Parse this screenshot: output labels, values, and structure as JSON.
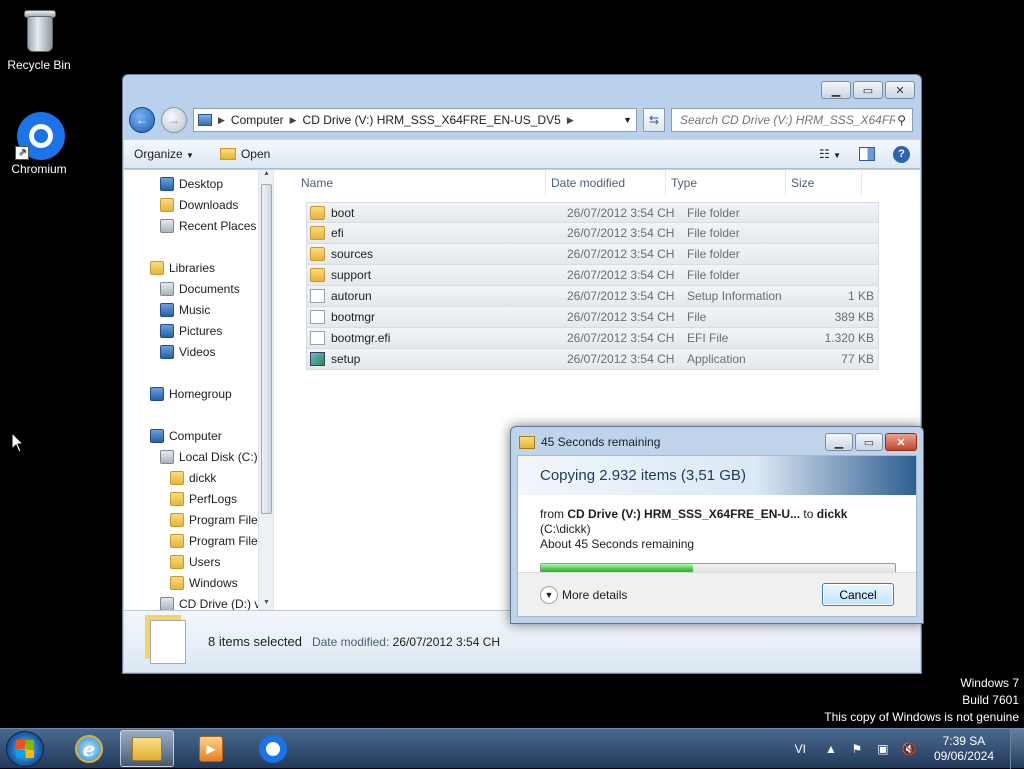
{
  "desktop": {
    "icons": [
      {
        "label": "Recycle Bin",
        "icon": "recycle-bin-icon"
      },
      {
        "label": "Chromium",
        "icon": "chromium-icon"
      }
    ],
    "watermark": [
      "Windows 7",
      "Build 7601",
      "This copy of Windows is not genuine"
    ]
  },
  "explorer": {
    "address": {
      "crumbs": [
        "Computer",
        "CD Drive (V:) HRM_SSS_X64FRE_EN-US_DV5"
      ]
    },
    "search_placeholder": "Search CD Drive (V:) HRM_SSS_X64FR...",
    "toolbar": {
      "organize": "Organize",
      "open": "Open"
    },
    "nav": {
      "favorites": [
        "Desktop",
        "Downloads",
        "Recent Places"
      ],
      "libraries_label": "Libraries",
      "libraries": [
        "Documents",
        "Music",
        "Pictures",
        "Videos"
      ],
      "homegroup": "Homegroup",
      "computer_label": "Computer",
      "local_disk": "Local Disk (C:)",
      "local_disk_children": [
        "dickk",
        "PerfLogs",
        "Program Files",
        "Program Files (",
        "Users",
        "Windows"
      ],
      "cd_drive": "CD Drive (D:) virt"
    },
    "columns": [
      "Name",
      "Date modified",
      "Type",
      "Size"
    ],
    "files": [
      {
        "name": "boot",
        "date": "26/07/2012 3:54 CH",
        "type": "File folder",
        "size": "",
        "icon": "folder"
      },
      {
        "name": "efi",
        "date": "26/07/2012 3:54 CH",
        "type": "File folder",
        "size": "",
        "icon": "folder"
      },
      {
        "name": "sources",
        "date": "26/07/2012 3:54 CH",
        "type": "File folder",
        "size": "",
        "icon": "folder"
      },
      {
        "name": "support",
        "date": "26/07/2012 3:54 CH",
        "type": "File folder",
        "size": "",
        "icon": "folder"
      },
      {
        "name": "autorun",
        "date": "26/07/2012 3:54 CH",
        "type": "Setup Information",
        "size": "1 KB",
        "icon": "file"
      },
      {
        "name": "bootmgr",
        "date": "26/07/2012 3:54 CH",
        "type": "File",
        "size": "389 KB",
        "icon": "file"
      },
      {
        "name": "bootmgr.efi",
        "date": "26/07/2012 3:54 CH",
        "type": "EFI File",
        "size": "1.320 KB",
        "icon": "file"
      },
      {
        "name": "setup",
        "date": "26/07/2012 3:54 CH",
        "type": "Application",
        "size": "77 KB",
        "icon": "app"
      }
    ],
    "details": {
      "selected": "8 items selected",
      "date_label": "Date modified:",
      "date_value": "26/07/2012 3:54 CH"
    }
  },
  "copy_dialog": {
    "title": "45 Seconds remaining",
    "heading": "Copying 2.932 items (3,51 GB)",
    "from_label": "from",
    "from_value": "CD Drive (V:) HRM_SSS_X64FRE_EN-U...",
    "to_label": "to",
    "to_value": "dickk",
    "to_path": "(C:\\dickk)",
    "remaining": "About 45 Seconds remaining",
    "progress": 0.43,
    "more_details": "More details",
    "cancel": "Cancel"
  },
  "taskbar": {
    "lang": "VI",
    "time": "7:39 SA",
    "date": "09/06/2024"
  }
}
